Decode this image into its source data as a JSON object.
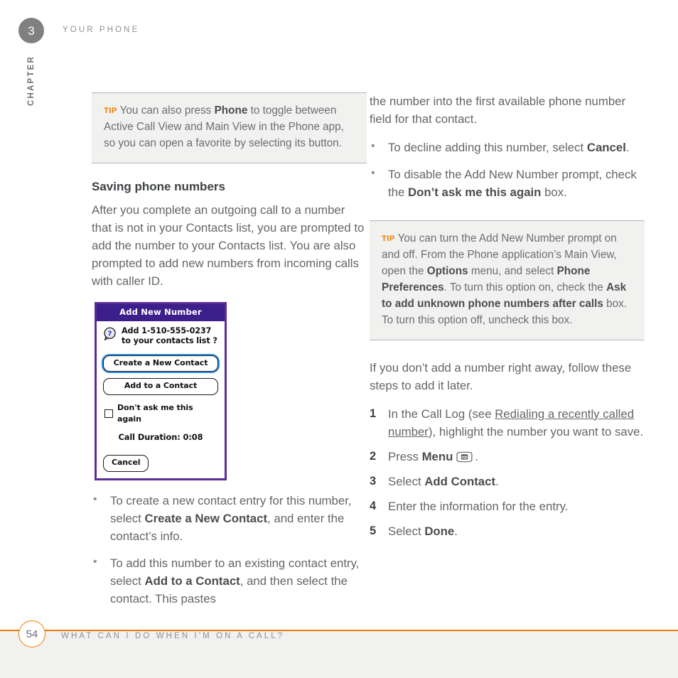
{
  "page": {
    "chapter_number": "3",
    "chapter_label": "CHAPTER",
    "running_head": "YOUR PHONE",
    "page_number": "54",
    "footer_title": "WHAT CAN I DO WHEN I'M ON A CALL?",
    "accent_color": "#ee7900",
    "chapter_badge_color": "#808080",
    "body_text_color": "#636669"
  },
  "left_column": {
    "tip": {
      "label": "TIP",
      "parts": [
        {
          "text": "You can also press ",
          "bold": false
        },
        {
          "text": "Phone",
          "bold": true
        },
        {
          "text": " to toggle between Active Call View and Main View in the Phone app, so you can open a favorite by selecting its button.",
          "bold": false
        }
      ]
    },
    "heading": "Saving phone numbers",
    "paragraph": "After you complete an outgoing call to a number that is not in your Contacts list, you are prompted to add the number to your Contacts list. You are also prompted to add new numbers from incoming calls with caller ID.",
    "screenshot": {
      "title": "Add New Number",
      "icon": "question-mark-icon",
      "prompt_line1": "Add 1-510-555-0237",
      "prompt_line2": "to your contacts list ?",
      "button_primary": "Create a New Contact",
      "button_secondary": "Add to a Contact",
      "checkbox_label": "Don't ask me this again",
      "checkbox_checked": false,
      "duration_text": "Call Duration: 0:08",
      "button_cancel": "Cancel",
      "title_bar_color": "#3d1f8c",
      "border_color": "#5b2d93",
      "focus_ring_color": "#2f8fe8"
    },
    "bullets": [
      [
        {
          "text": "To create a new contact entry for this number, select ",
          "bold": false
        },
        {
          "text": "Create a New Contact",
          "bold": true
        },
        {
          "text": ", and enter the contact’s info.",
          "bold": false
        }
      ],
      [
        {
          "text": "To add this number to an existing contact entry, select ",
          "bold": false
        },
        {
          "text": "Add to a Contact",
          "bold": true
        },
        {
          "text": ", and then select the contact. This pastes",
          "bold": false
        }
      ]
    ]
  },
  "right_column": {
    "continued_paragraph": "the number into the first available phone number field for that contact.",
    "bullets": [
      [
        {
          "text": "To decline adding this number, select ",
          "bold": false
        },
        {
          "text": "Cancel",
          "bold": true
        },
        {
          "text": ".",
          "bold": false
        }
      ],
      [
        {
          "text": "To disable the Add New Number prompt, check the ",
          "bold": false
        },
        {
          "text": "Don’t ask me this again",
          "bold": true
        },
        {
          "text": " box.",
          "bold": false
        }
      ]
    ],
    "tip": {
      "label": "TIP",
      "parts": [
        {
          "text": "You can turn the Add New Number prompt on and off. From the Phone application’s Main View, open the ",
          "bold": false
        },
        {
          "text": "Options",
          "bold": true
        },
        {
          "text": " menu, and select ",
          "bold": false
        },
        {
          "text": "Phone Preferences",
          "bold": true
        },
        {
          "text": ". To turn this option on, check the ",
          "bold": false
        },
        {
          "text": "Ask to add unknown phone numbers after calls",
          "bold": true
        },
        {
          "text": " box. To turn this option off, uncheck this box.",
          "bold": false
        }
      ]
    },
    "intro_paragraph": "If you don’t add a number right away, follow these steps to add it later.",
    "steps": [
      {
        "number": "1",
        "parts": [
          {
            "text": "In the Call Log (see ",
            "bold": false
          },
          {
            "text": "Redialing a recently called number",
            "bold": false,
            "link": true
          },
          {
            "text": "), highlight the number you want to save.",
            "bold": false
          }
        ]
      },
      {
        "number": "2",
        "parts": [
          {
            "text": "Press ",
            "bold": false
          },
          {
            "text": "Menu",
            "bold": true
          },
          {
            "icon": "menu-key-icon"
          },
          {
            "text": ".",
            "bold": false
          }
        ]
      },
      {
        "number": "3",
        "parts": [
          {
            "text": "Select ",
            "bold": false
          },
          {
            "text": "Add Contact",
            "bold": true
          },
          {
            "text": ".",
            "bold": false
          }
        ]
      },
      {
        "number": "4",
        "parts": [
          {
            "text": "Enter the information for the entry.",
            "bold": false
          }
        ]
      },
      {
        "number": "5",
        "parts": [
          {
            "text": "Select ",
            "bold": false
          },
          {
            "text": "Done",
            "bold": true
          },
          {
            "text": ".",
            "bold": false
          }
        ]
      }
    ]
  }
}
